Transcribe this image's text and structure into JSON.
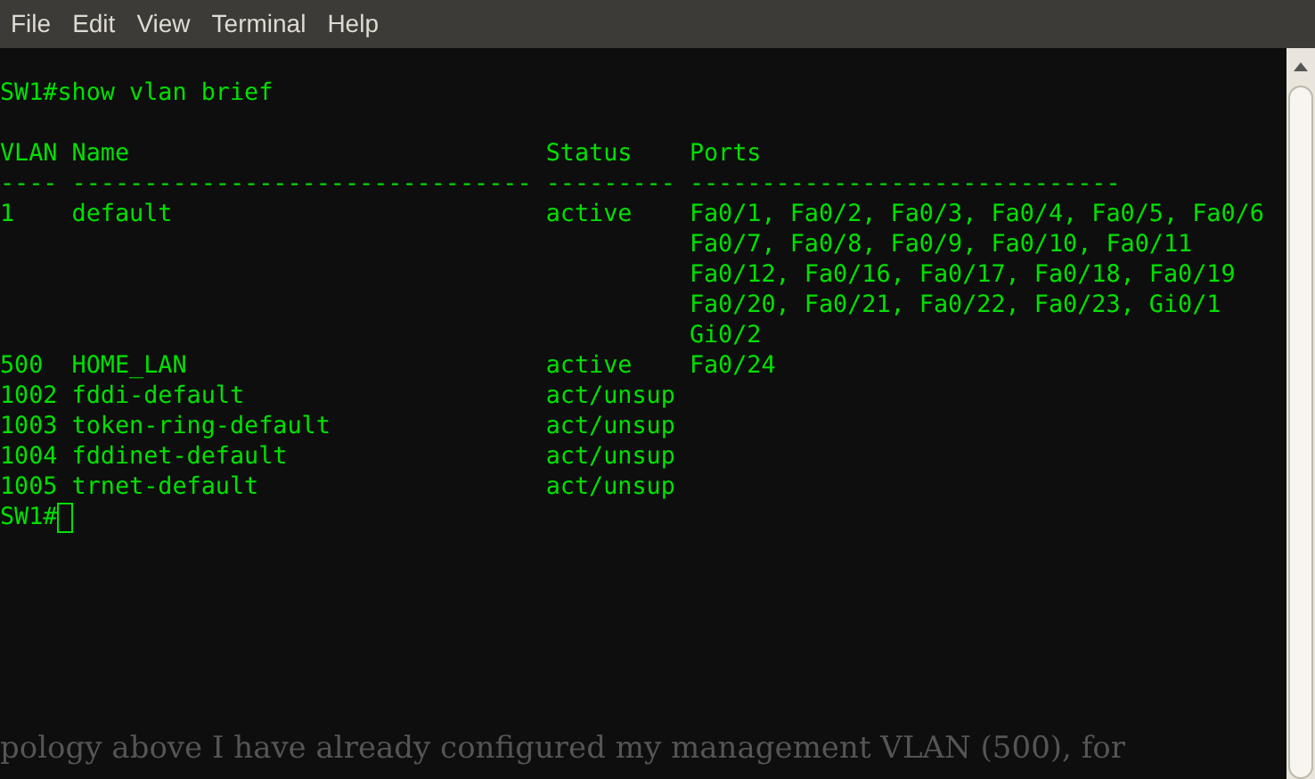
{
  "menu": [
    "File",
    "Edit",
    "View",
    "Terminal",
    "Help"
  ],
  "command": "SW1#show vlan brief",
  "columns": [
    "VLAN",
    "Name",
    "Status",
    "Ports"
  ],
  "rules": [
    "----",
    "--------------------------------",
    "---------",
    "------------------------------"
  ],
  "rows": [
    {
      "vlan": "1",
      "name": "default",
      "status": "active",
      "ports": [
        "Fa0/1, Fa0/2, Fa0/3, Fa0/4, Fa0/5, Fa0/6",
        "Fa0/7, Fa0/8, Fa0/9, Fa0/10, Fa0/11",
        "Fa0/12, Fa0/16, Fa0/17, Fa0/18, Fa0/19",
        "Fa0/20, Fa0/21, Fa0/22, Fa0/23, Gi0/1",
        "Gi0/2"
      ]
    },
    {
      "vlan": "500",
      "name": "HOME_LAN",
      "status": "active",
      "ports": [
        "Fa0/24"
      ]
    },
    {
      "vlan": "1002",
      "name": "fddi-default",
      "status": "act/unsup",
      "ports": []
    },
    {
      "vlan": "1003",
      "name": "token-ring-default",
      "status": "act/unsup",
      "ports": []
    },
    {
      "vlan": "1004",
      "name": "fddinet-default",
      "status": "act/unsup",
      "ports": []
    },
    {
      "vlan": "1005",
      "name": "trnet-default",
      "status": "act/unsup",
      "ports": []
    }
  ],
  "prompt": "SW1#",
  "background_text": "pology above I have already configured my management VLAN (500), for"
}
